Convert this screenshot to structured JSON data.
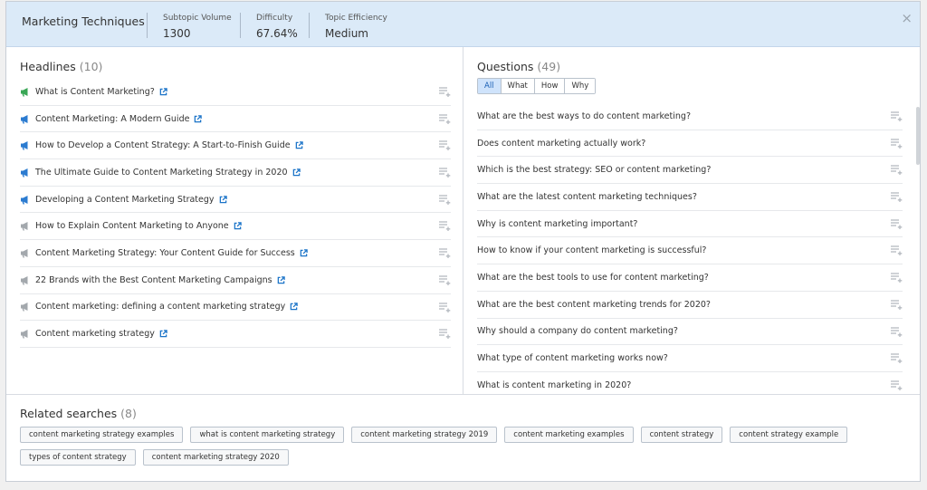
{
  "header": {
    "title": "Marketing Techniques",
    "metrics": [
      {
        "label": "Subtopic Volume",
        "value": "1300"
      },
      {
        "label": "Difficulty",
        "value": "67.64%"
      },
      {
        "label": "Topic Efficiency",
        "value": "Medium"
      }
    ],
    "close_symbol": "×"
  },
  "headlines": {
    "title": "Headlines",
    "count": "(10)",
    "items": [
      {
        "text": "What is Content Marketing?",
        "icon": "megaphone-green-icon"
      },
      {
        "text": "Content Marketing: A Modern Guide",
        "icon": "megaphone-blue-icon"
      },
      {
        "text": "How to Develop a Content Strategy: A Start-to-Finish Guide",
        "icon": "megaphone-blue-icon"
      },
      {
        "text": "The Ultimate Guide to Content Marketing Strategy in 2020",
        "icon": "megaphone-blue-icon"
      },
      {
        "text": "Developing a Content Marketing Strategy",
        "icon": "megaphone-blue-icon"
      },
      {
        "text": "How to Explain Content Marketing to Anyone",
        "icon": "megaphone-gray-icon"
      },
      {
        "text": "Content Marketing Strategy: Your Content Guide for Success",
        "icon": "megaphone-gray-icon"
      },
      {
        "text": "22 Brands with the Best Content Marketing Campaigns",
        "icon": "megaphone-gray-icon"
      },
      {
        "text": "Content marketing: defining a content marketing strategy",
        "icon": "megaphone-gray-icon"
      },
      {
        "text": "Content marketing strategy",
        "icon": "megaphone-gray-icon"
      }
    ]
  },
  "questions": {
    "title": "Questions",
    "count": "(49)",
    "filters": [
      "All",
      "What",
      "How",
      "Why"
    ],
    "active_filter": "All",
    "items": [
      "What are the best ways to do content marketing?",
      "Does content marketing actually work?",
      "Which is the best strategy: SEO or content marketing?",
      "What are the latest content marketing techniques?",
      "Why is content marketing important?",
      "How to know if your content marketing is successful?",
      "What are the best tools to use for content marketing?",
      "What are the best content marketing trends for 2020?",
      "Why should a company do content marketing?",
      "What type of content marketing works now?",
      "What is content marketing in 2020?"
    ]
  },
  "related": {
    "title": "Related searches",
    "count": "(8)",
    "chips": [
      "content marketing strategy examples",
      "what is content marketing strategy",
      "content marketing strategy 2019",
      "content marketing examples",
      "content strategy",
      "content strategy example",
      "types of content strategy",
      "content marketing strategy 2020"
    ]
  },
  "colors": {
    "header_bg": "#dbeaf8",
    "link_blue": "#1a73c8",
    "active_filter_bg": "#cfe3fb",
    "megaphone_green": "#3aa756",
    "megaphone_blue": "#2b7bd0",
    "megaphone_gray": "#a3a8ad"
  }
}
